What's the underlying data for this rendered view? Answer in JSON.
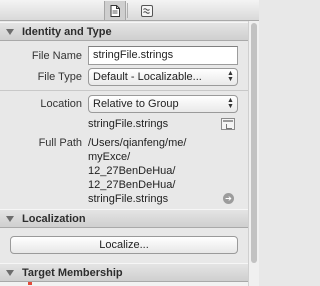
{
  "tabs": [
    {
      "name": "file-inspector",
      "icon": "file-icon",
      "active": true
    },
    {
      "name": "quick-help",
      "icon": "quick-help-icon",
      "active": false
    }
  ],
  "identity": {
    "title": "Identity and Type",
    "file_name_label": "File Name",
    "file_name_value": "stringFile.strings",
    "file_type_label": "File Type",
    "file_type_value": "Default - Localizable...",
    "location_label": "Location",
    "location_value": "Relative to Group",
    "location_file": "stringFile.strings",
    "full_path_label": "Full Path",
    "full_path_lines": [
      "/Users/qianfeng/me/",
      "myExce/",
      "12_27BenDeHua/",
      "12_27BenDeHua/",
      "stringFile.strings"
    ]
  },
  "localization": {
    "title": "Localization",
    "button_label": "Localize..."
  },
  "target_membership": {
    "title": "Target Membership"
  },
  "colors": {
    "panel_bg": "#e8e8e8",
    "header_bg": "#d6d6d6",
    "accent_red": "#e24b3b"
  }
}
